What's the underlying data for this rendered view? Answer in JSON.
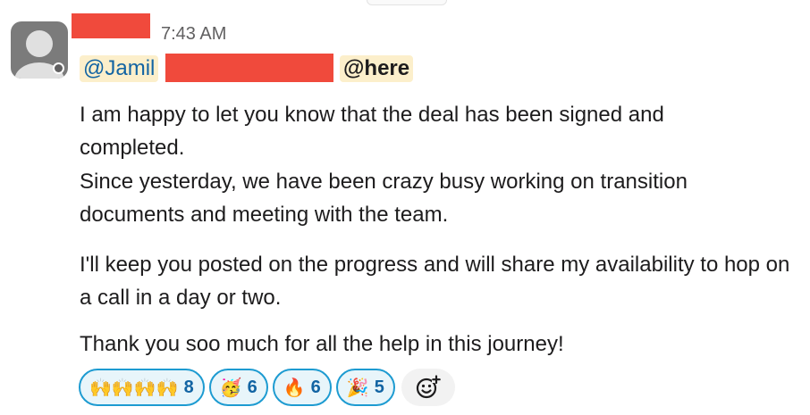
{
  "message": {
    "timestamp": "7:43 AM",
    "mentions": {
      "user": "@Jamil",
      "here": "@here"
    },
    "paragraphs": [
      "I am happy to let you know that the deal has been signed and completed.",
      "Since yesterday, we have been crazy busy working on transition documents and meeting with the team.",
      "I'll keep you posted on the progress and will share my availability to hop on a call in a day or two.",
      "Thank you soo much for all the help in this journey!"
    ]
  },
  "reactions": [
    {
      "emoji": "🙌🙌🙌🙌",
      "count": "8",
      "icon": "raising-hands-skin-tones"
    },
    {
      "emoji": "🥳",
      "count": "6",
      "icon": "partying-face"
    },
    {
      "emoji": "🔥",
      "count": "6",
      "icon": "fire"
    },
    {
      "emoji": "🎉",
      "count": "5",
      "icon": "party-popper"
    }
  ],
  "add_reaction": {
    "icon": "add-emoji-icon"
  },
  "colors": {
    "accent": "#1264a3",
    "mention_bg": "#fcefcb",
    "reaction_border": "#1d9bd1",
    "reaction_bg": "#e8f5fa",
    "redaction": "#f04a3c"
  }
}
